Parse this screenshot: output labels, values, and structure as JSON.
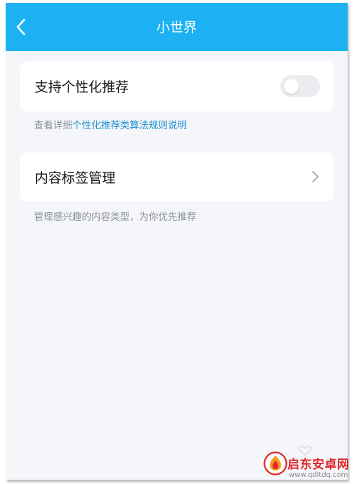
{
  "header": {
    "title": "小世界",
    "back_icon": "chevron-left-icon"
  },
  "personalized": {
    "label": "支持个性化推荐",
    "enabled": false,
    "hint_prefix": "查看详细",
    "hint_link": "个性化推荐类算法规则说明"
  },
  "content_tags": {
    "label": "内容标签管理",
    "hint": "管理感兴趣的内容类型，为你优先推荐"
  },
  "watermark": {
    "name": "启东安卓网",
    "url": "www.qdltdq.com"
  },
  "colors": {
    "header": "#1cb1f2",
    "link": "#1c8fd1",
    "background": "#f5f6fa",
    "toggle_off": "#eaecf0"
  }
}
